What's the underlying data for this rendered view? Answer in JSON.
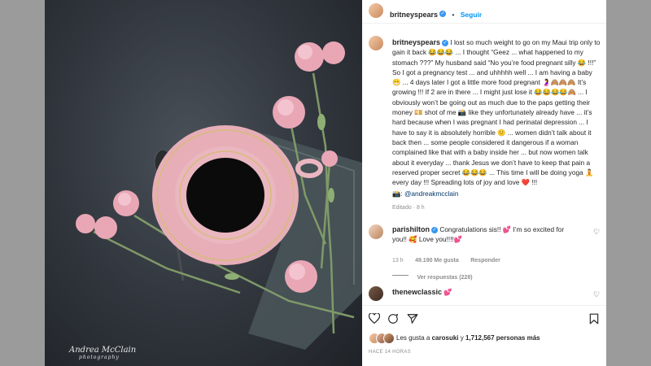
{
  "post": {
    "username": "britneyspears",
    "follow_label": "Seguir",
    "photo_credit_line1": "Andrea McClain",
    "photo_credit_line2": "photography",
    "caption": "I lost so much weight to go on my Maui trip only to gain it back 😂😂😂 ... I thought “Geez ... what happened to my stomach ???” My husband said “No you’re food pregnant silly 😂 !!!” So I got a pregnancy test ... and uhhhhh well ... I am having a baby 😁 ... 4 days later I got a little more food pregnant 🤰🙈🙈🙈 It’s growing !!! If 2 are in there ... I might just lose it 😂😂😂😂🙈 ... I obviously won’t be going out as much due to the paps getting their money 💴 shot of me 📸 like they unfortunately already have ... it’s hard because when I was pregnant I had perinatal depression ... I have to say it is absolutely horrible 😕 ... women didn’t talk about it back then ... some people considered it dangerous if a woman complained like that with a baby inside her ... but now women talk about it everyday ... thank Jesus we don’t have to keep that pain a reserved proper secret 😂😂😂 ... This time I will be doing yoga 🧘 every day !!! Spreading lots of joy and love ❤️ !!!",
    "credit_prefix": "📸:",
    "credit_handle": "@andreakmcclain",
    "edited_label": "Editado · 8 h"
  },
  "comments": [
    {
      "username": "parishilton",
      "text": "Congratulations sis!! 💕 I’m so excited for you!! 🥰 Love you!!!!💕",
      "time": "13 h",
      "likes": "49.190 Me gusta",
      "reply_label": "Responder",
      "view_replies": "Ver respuestas (228)"
    },
    {
      "username": "thenewclassic",
      "text": "💕"
    }
  ],
  "footer": {
    "likes_text_prefix": "Les gusta a",
    "likes_user": "carosuki",
    "likes_text_middle": "y",
    "likes_count": "1,712,567 personas más",
    "posted_ago": "HACE 14 HORAS"
  }
}
